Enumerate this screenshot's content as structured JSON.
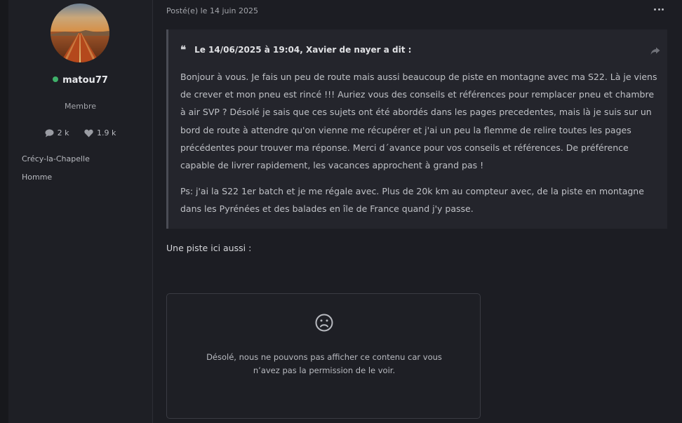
{
  "author": {
    "avatar": "road-avatar",
    "username": "matou77",
    "status_color": "#3fb06a",
    "role": "Membre",
    "comments_count": "2 k",
    "likes_count": "1.9 k",
    "location": "Crécy-la-Chapelle",
    "gender": "Homme"
  },
  "post": {
    "date": "Posté(e) le 14 juin 2025",
    "quote": {
      "header": "Le 14/06/2025 à 19:04, Xavier de nayer a dit :",
      "paragraphs": [
        "Bonjour à vous. Je fais un peu de route mais aussi beaucoup de piste en montagne avec ma S22. Là je viens de crever et mon pneu est rincé !!! Auriez vous des conseils et références pour remplacer pneu et chambre à air SVP ? Désolé je sais que ces sujets ont été abordés dans les pages precedentes, mais là je suis sur un bord de route à attendre qu'on vienne me récupérer et j'ai un peu la flemme de relire toutes les pages précédentes pour trouver ma réponse. Merci d´avance pour vos conseils et références. De préférence capable de livrer rapidement, les vacances approchent à grand pas !",
        "Ps: j'ai la S22 1er batch et je me régale avec. Plus de 20k km au compteur avec, de la piste en montagne dans les Pyrénées et des balades en île de France quand j'y passe."
      ]
    },
    "reply": "Une piste ici aussi :",
    "embed_message": "Désolé, nous ne pouvons pas afficher ce contenu car vous n’avez pas la permission de le voir."
  }
}
